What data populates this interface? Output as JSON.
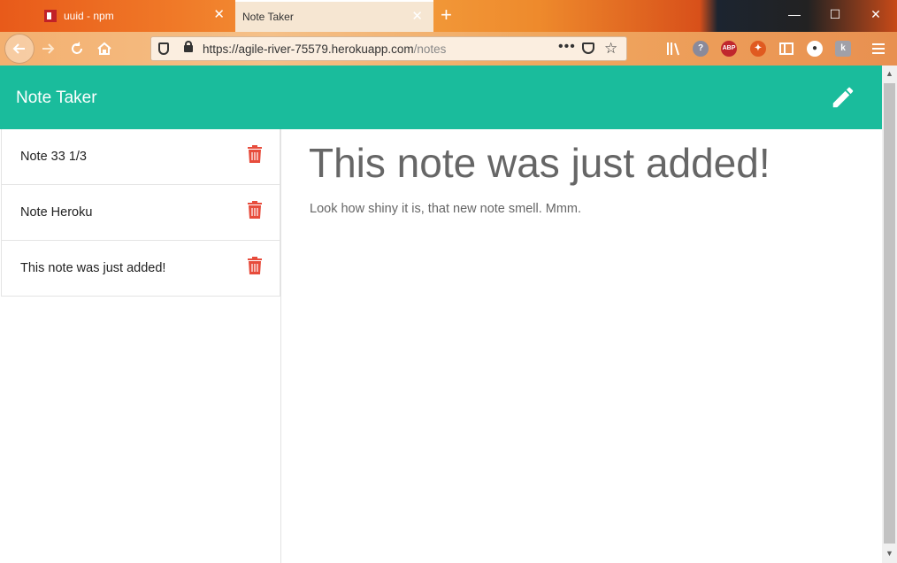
{
  "browser": {
    "tabs": [
      {
        "title": "uuid - npm",
        "close": "✕"
      },
      {
        "title": "Note Taker",
        "close": "✕"
      }
    ],
    "new_tab": "+",
    "url_host": "https://agile-river-75579.herokuapp.com",
    "url_path": "/notes",
    "page_actions": "•••",
    "window_controls": {
      "minimize": "—",
      "maximize": "☐",
      "close": "✕"
    },
    "extensions": [
      "library-icon",
      "help-icon",
      "adblock-icon",
      "firefox-icon",
      "sidebar-icon",
      "account-icon",
      "extension-icon",
      "menu-icon"
    ],
    "abp_label": "ABP"
  },
  "app": {
    "title": "Note Taker",
    "accent_color": "#1abc9c",
    "delete_color": "#e74c3c",
    "notes": [
      {
        "title": "Note 33 1/3"
      },
      {
        "title": "Note Heroku"
      },
      {
        "title": "This note was just added!"
      }
    ],
    "active_note": {
      "title": "This note was just added!",
      "text": "Look how shiny it is, that new note smell. Mmm."
    }
  }
}
